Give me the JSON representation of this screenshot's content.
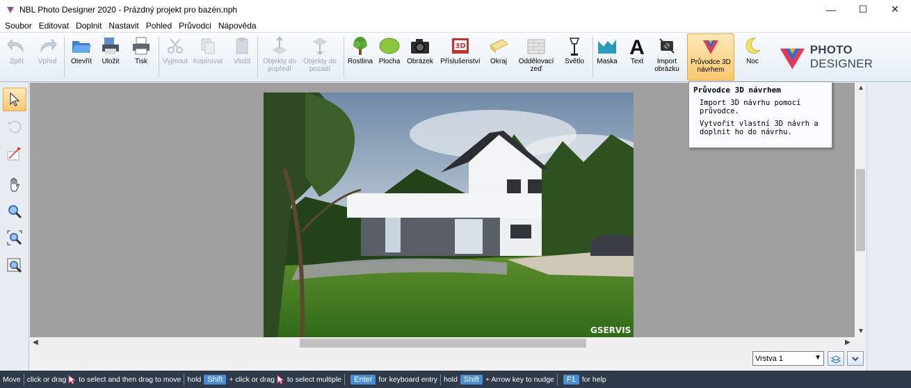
{
  "window": {
    "title": "NBL Photo Designer 2020 - Prázdný projekt pro bazén.nph",
    "minimize": "—",
    "maximize": "☐",
    "close": "✕"
  },
  "menu": [
    "Soubor",
    "Editovat",
    "Doplnit",
    "Nastavit",
    "Pohled",
    "Průvodci",
    "Nápověda"
  ],
  "toolbar": {
    "back": "Zpět",
    "forward": "Vpřed",
    "open": "Otevřít",
    "save": "Uložit",
    "print": "Tisk",
    "cut": "Vyjmout",
    "copy": "Kopírovat",
    "paste": "Vložit",
    "to_front_1": "Objekty do",
    "to_front_2": "popředí",
    "to_back_1": "Objekty do",
    "to_back_2": "pozadí",
    "plant": "Rostlina",
    "area": "Plocha",
    "image": "Obrázek",
    "accessories": "Příslušenství",
    "edge": "Okraj",
    "wall_1": "Oddělovací",
    "wall_2": "zeď",
    "light": "Světlo",
    "mask": "Maska",
    "text": "Text",
    "import_1": "Import",
    "import_2": "obrázku",
    "wizard_1": "Průvodce 3D",
    "wizard_2": "návrhem",
    "night": "Noc"
  },
  "brand": {
    "photo": "PHOTO",
    "designer": " DESIGNER"
  },
  "tooltip": {
    "title": "Průvodce 3D návrhem",
    "line1": "Import 3D návrhu pomocí průvodce.",
    "line2": "Vytvořit vlastní 3D návrh a doplnit ho do návrhu."
  },
  "photo_watermark": "GSERVIS",
  "layer": {
    "value": "Vrstva 1"
  },
  "status": {
    "mode": "Move",
    "t1": "click or drag",
    "t2": "to select and then drag to move",
    "t3": "hold",
    "k_shift": "Shift",
    "t4": "+ click or drag",
    "t5": "to select multiple",
    "k_enter": "Enter",
    "t6": "for keyboard entry",
    "t7": "hold",
    "k_shift2": "Shift",
    "t8": "+ Arrow key to nudge",
    "k_f1": "F1",
    "t9": "for help"
  },
  "colors": {
    "accent": "#f8c86e",
    "statusbar": "#2f3b4b",
    "key": "#4a8fd6",
    "canvas": "#a0a0a0"
  }
}
